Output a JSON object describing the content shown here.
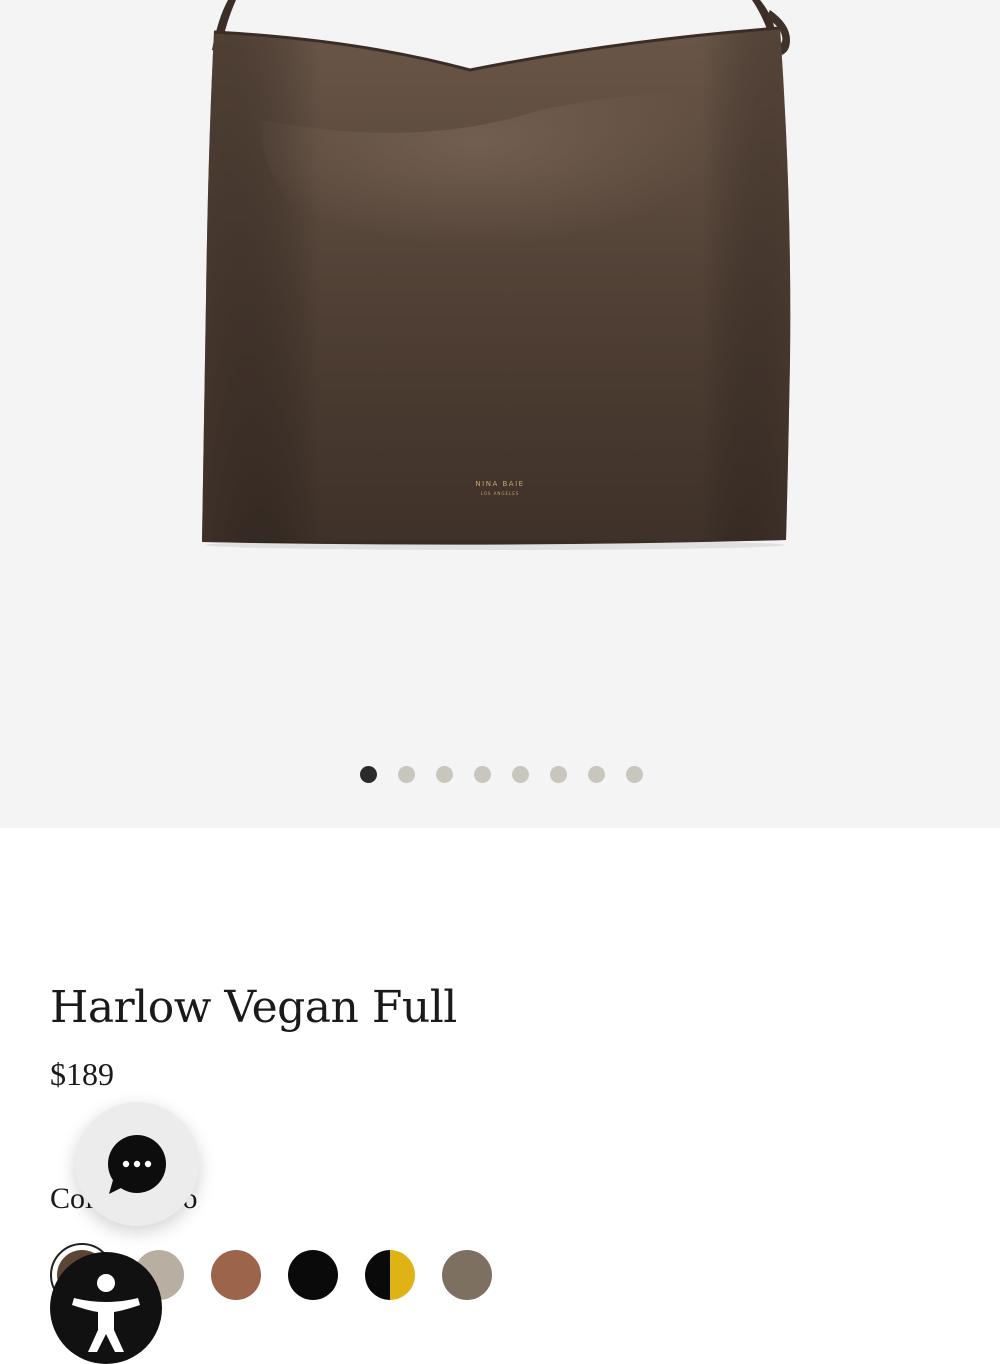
{
  "product": {
    "title": "Harlow Vegan Full",
    "price": "$189",
    "color_label": "Color: Coco",
    "brand_mark": "NINA BAIE",
    "brand_mark_sub": "LOS ANGELES"
  },
  "gallery": {
    "slide_count": 8,
    "active_slide": 1
  },
  "swatches": [
    {
      "name": "coco",
      "color": "#5b4636",
      "selected": true
    },
    {
      "name": "taupe",
      "color": "#b8aea1",
      "selected": false
    },
    {
      "name": "cognac",
      "color": "#9b644b",
      "selected": false
    },
    {
      "name": "black",
      "color": "#0a0a0a",
      "selected": false
    },
    {
      "name": "black-yellow",
      "color": "#0a0a0a",
      "accent": "#e0b315",
      "selected": false
    },
    {
      "name": "grey-brown",
      "color": "#7e7061",
      "selected": false
    }
  ],
  "widgets": {
    "chat_icon": "chat-bubble-icon",
    "accessibility_icon": "accessibility-person-icon"
  },
  "colors": {
    "hero_bg": "#f4f4f4",
    "bag": "#55443a",
    "inactive_dot": "#c9c6bd",
    "active_dot": "#2a2a2a"
  }
}
